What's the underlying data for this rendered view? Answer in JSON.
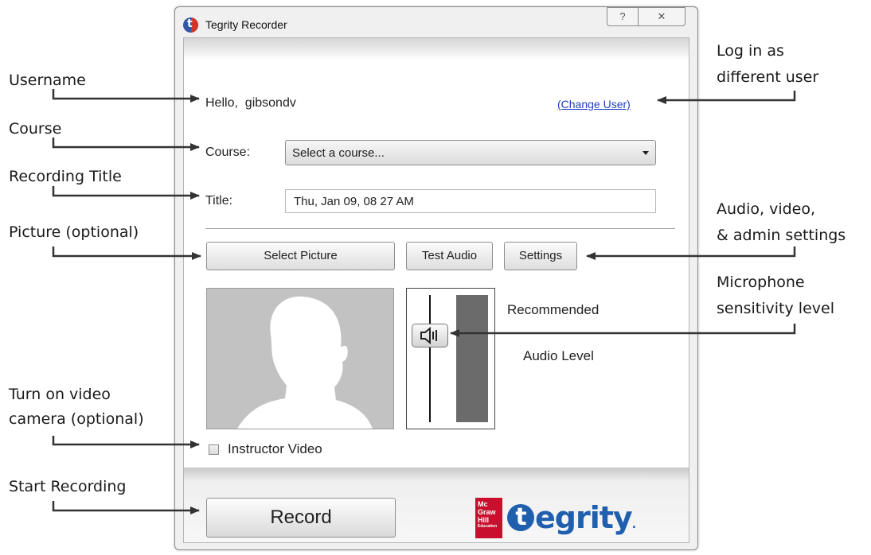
{
  "window": {
    "title": "Tegrity Recorder",
    "help_glyph": "?",
    "close_glyph": "✕",
    "greeting_prefix": "Hello,",
    "username": "gibsondv",
    "change_user_link": "(Change User)",
    "course_label": "Course:",
    "course_selected": "Select a course...",
    "title_label": "Title:",
    "title_value": "Thu, Jan 09, 08 27 AM",
    "select_picture_button": "Select Picture",
    "test_audio_button": "Test Audio",
    "settings_button": "Settings",
    "recommended_label": "Recommended",
    "audio_level_label": "Audio Level",
    "instructor_video_label": "Instructor Video",
    "instructor_video_checked": false,
    "record_button": "Record",
    "logo_mhe_lines": [
      "Mc",
      "Graw",
      "Hill",
      "Education"
    ],
    "logo_brand": "egrity",
    "logo_brand_initial": "t",
    "logo_trademark": "."
  },
  "annotations": {
    "username": "Username",
    "course": "Course",
    "recording_title": "Recording Title",
    "picture": "Picture (optional)",
    "video_line1": "Turn on video",
    "video_line2": "camera (optional)",
    "start_recording": "Start Recording",
    "login_line1": "Log in as",
    "login_line2": "different user",
    "settings_line1": "Audio, video,",
    "settings_line2": "& admin settings",
    "mic_line1": "Microphone",
    "mic_line2": "sensitivity level"
  },
  "colors": {
    "link": "#1f3fc6",
    "brand_blue": "#1f5fae",
    "brand_red": "#c8102e",
    "picture_bg": "#c2c2c2",
    "meter_bar": "#6b6b6b"
  }
}
